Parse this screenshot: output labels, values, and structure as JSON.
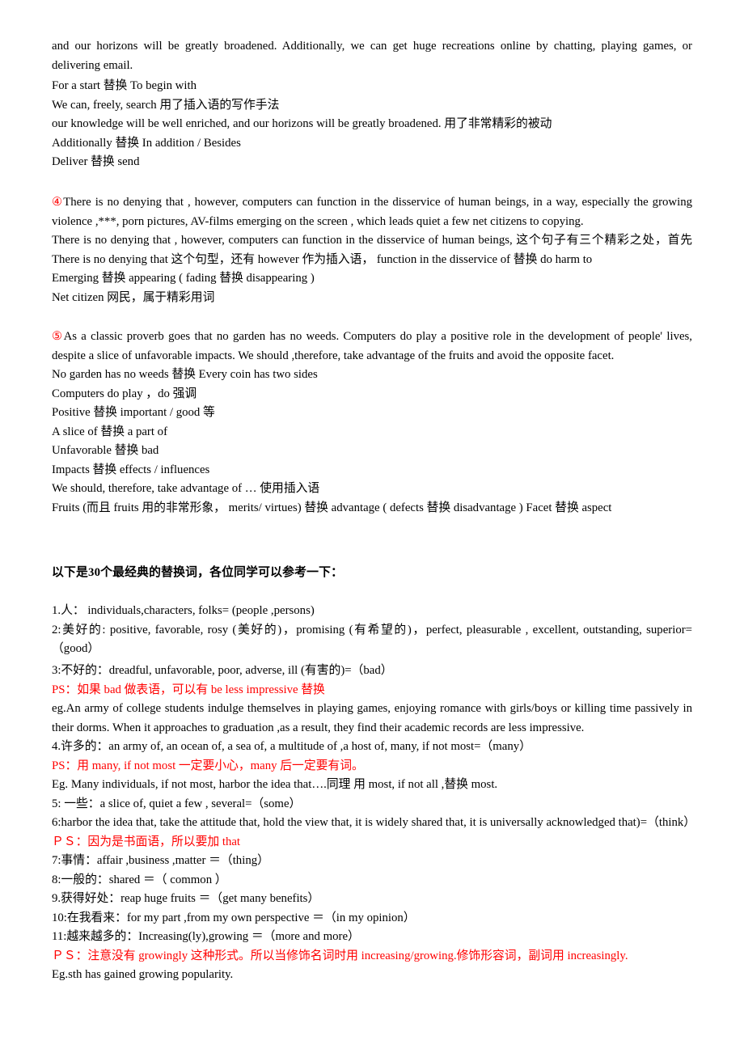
{
  "document": {
    "title_heading": "以下是30个最经典的替换词，各位同学可以参考一下：",
    "section_top": {
      "paragraph_lines": [
        "and our horizons will be greatly broadened. Additionally, we can get huge recreations online by chatting, playing games, or delivering email."
      ],
      "notes": [
        "For a start  替换  To begin with",
        "We can, freely, search  用了插入语的写作手法",
        "our knowledge will be well enriched, and our horizons will be greatly broadened.  用了非常精彩的被动",
        "Additionally  替换  In addition / Besides",
        "Deliver  替换  send"
      ]
    },
    "section_four": {
      "marker": "④",
      "paragraph": "There is no denying that , however, computers can function in the disservice of human beings, in a way, especially the growing violence ,***, porn pictures, AV-films emerging on the screen , which leads quiet a few net citizens to copying.",
      "notes": [
        "There is no denying that , however, computers can function in the disservice of human beings,  这个句子有三个精彩之处，首先 There is no denying that 这个句型，还有 however 作为插入语，   function in the disservice of  替换  do harm to",
        "Emerging  替换  appearing ( fading  替换  disappearing )",
        "Net citizen  网民，属于精彩用词"
      ]
    },
    "section_five": {
      "marker": "⑤",
      "paragraph": "As a classic proverb goes that no garden has no weeds. Computers do play a positive role in the development of people' lives, despite a slice of unfavorable impacts. We should ,therefore, take advantage of the fruits and avoid the opposite facet.",
      "notes": [
        "No garden has no weeds  替换  Every coin has two sides",
        "Computers do play ，do  强调",
        "Positive  替换  important / good  等",
        "A slice of  替换  a part of",
        "Unfavorable  替换  bad",
        "Impacts  替换  effects / influences",
        "We should, therefore, take advantage of …  使用插入语",
        "Fruits (而且 fruits  用的非常形象，   merits/ virtues)  替换  advantage ( defects  替换  disadvantage )   Facet  替换  aspect"
      ]
    },
    "word_list": [
      {
        "id": "1",
        "text": "1.人：  individuals,characters, folks= (people ,persons)"
      },
      {
        "id": "2",
        "text": "2:美好的: positive, favorable, rosy (美好的)，promising (有希望的)，perfect, pleasurable , excellent, outstanding, superior=（good）"
      },
      {
        "id": "3",
        "text": "3:不好的：dreadful, unfavorable, poor, adverse, ill (有害的)=（bad）"
      },
      {
        "id": "3ps",
        "text": "PS：如果 bad 做表语，可以有 be less impressive 替换",
        "red": true
      },
      {
        "id": "3eg",
        "text": "eg.An army of college students indulge themselves in playing games, enjoying romance with girls/boys or killing time passively in their dorms. When it approaches to graduation ,as a result, they find their academic records are less impressive."
      },
      {
        "id": "4",
        "text": "4.许多的：an army of, an ocean of, a sea of, a multitude of ,a host of, many, if not most=（many）"
      },
      {
        "id": "4ps",
        "text": "PS：用 many, if not most  一定要小心，many 后一定要有词。",
        "red": true
      },
      {
        "id": "4eg",
        "text": "Eg. Many individuals, if not most, harbor the idea that….同理 用 most, if not all ,替换 most."
      },
      {
        "id": "5",
        "text": "5: 一些：a slice of, quiet a few , several=（some）"
      },
      {
        "id": "6",
        "text": "6:harbor the idea that, take the attitude that, hold the view that, it is widely shared that, it is universally acknowledged that)=（think）"
      },
      {
        "id": "6ps",
        "text": "ＰＳ：因为是书面语，所以要加 that",
        "red": true
      },
      {
        "id": "7",
        "text": "7:事情：affair ,business ,matter ＝（thing）"
      },
      {
        "id": "8",
        "text": "8:一般的：shared ＝（ common ）"
      },
      {
        "id": "9",
        "text": "9.获得好处：reap huge fruits ＝（get many benefits）"
      },
      {
        "id": "10",
        "text": "10:在我看来：for my part ,from my own perspective ＝（in my opinion）"
      },
      {
        "id": "11",
        "text": "11:越来越多的：Increasing(ly),growing ＝（more and more）"
      },
      {
        "id": "11ps",
        "text": "ＰＳ：注意没有 growingly 这种形式。所以当修饰名词时用 increasing/growing.修饰形容词，副词用 increasingly.",
        "red": true
      },
      {
        "id": "11eg",
        "text": "Eg.sth has gained growing popularity."
      }
    ],
    "colors": {
      "text": "#000000",
      "accent_red": "#ff0000"
    }
  }
}
